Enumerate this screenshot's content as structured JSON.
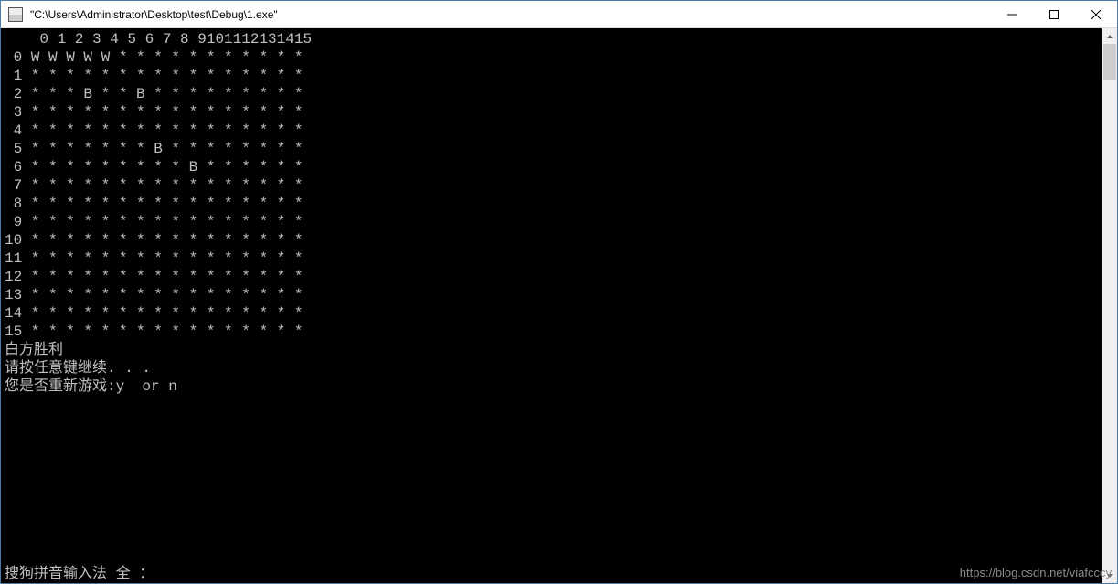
{
  "window": {
    "title": "\"C:\\Users\\Administrator\\Desktop\\test\\Debug\\1.exe\""
  },
  "board": {
    "size": 16,
    "empty": "*",
    "cells": [
      [
        "W",
        "W",
        "W",
        "W",
        "W",
        "*",
        "*",
        "*",
        "*",
        "*",
        "*",
        "*",
        "*",
        "*",
        "*",
        "*"
      ],
      [
        "*",
        "*",
        "*",
        "*",
        "*",
        "*",
        "*",
        "*",
        "*",
        "*",
        "*",
        "*",
        "*",
        "*",
        "*",
        "*"
      ],
      [
        "*",
        "*",
        "*",
        "B",
        "*",
        "*",
        "B",
        "*",
        "*",
        "*",
        "*",
        "*",
        "*",
        "*",
        "*",
        "*"
      ],
      [
        "*",
        "*",
        "*",
        "*",
        "*",
        "*",
        "*",
        "*",
        "*",
        "*",
        "*",
        "*",
        "*",
        "*",
        "*",
        "*"
      ],
      [
        "*",
        "*",
        "*",
        "*",
        "*",
        "*",
        "*",
        "*",
        "*",
        "*",
        "*",
        "*",
        "*",
        "*",
        "*",
        "*"
      ],
      [
        "*",
        "*",
        "*",
        "*",
        "*",
        "*",
        "*",
        "B",
        "*",
        "*",
        "*",
        "*",
        "*",
        "*",
        "*",
        "*"
      ],
      [
        "*",
        "*",
        "*",
        "*",
        "*",
        "*",
        "*",
        "*",
        "*",
        "B",
        "*",
        "*",
        "*",
        "*",
        "*",
        "*"
      ],
      [
        "*",
        "*",
        "*",
        "*",
        "*",
        "*",
        "*",
        "*",
        "*",
        "*",
        "*",
        "*",
        "*",
        "*",
        "*",
        "*"
      ],
      [
        "*",
        "*",
        "*",
        "*",
        "*",
        "*",
        "*",
        "*",
        "*",
        "*",
        "*",
        "*",
        "*",
        "*",
        "*",
        "*"
      ],
      [
        "*",
        "*",
        "*",
        "*",
        "*",
        "*",
        "*",
        "*",
        "*",
        "*",
        "*",
        "*",
        "*",
        "*",
        "*",
        "*"
      ],
      [
        "*",
        "*",
        "*",
        "*",
        "*",
        "*",
        "*",
        "*",
        "*",
        "*",
        "*",
        "*",
        "*",
        "*",
        "*",
        "*"
      ],
      [
        "*",
        "*",
        "*",
        "*",
        "*",
        "*",
        "*",
        "*",
        "*",
        "*",
        "*",
        "*",
        "*",
        "*",
        "*",
        "*"
      ],
      [
        "*",
        "*",
        "*",
        "*",
        "*",
        "*",
        "*",
        "*",
        "*",
        "*",
        "*",
        "*",
        "*",
        "*",
        "*",
        "*"
      ],
      [
        "*",
        "*",
        "*",
        "*",
        "*",
        "*",
        "*",
        "*",
        "*",
        "*",
        "*",
        "*",
        "*",
        "*",
        "*",
        "*"
      ],
      [
        "*",
        "*",
        "*",
        "*",
        "*",
        "*",
        "*",
        "*",
        "*",
        "*",
        "*",
        "*",
        "*",
        "*",
        "*",
        "*"
      ],
      [
        "*",
        "*",
        "*",
        "*",
        "*",
        "*",
        "*",
        "*",
        "*",
        "*",
        "*",
        "*",
        "*",
        "*",
        "*",
        "*"
      ]
    ]
  },
  "messages": {
    "winner": "白方胜利",
    "press_key": "请按任意键继续. . .",
    "restart_prompt": "您是否重新游戏:y  or n"
  },
  "ime": {
    "status": "搜狗拼音输入法 全 ："
  },
  "watermark": "https://blog.csdn.net/viafcccy"
}
